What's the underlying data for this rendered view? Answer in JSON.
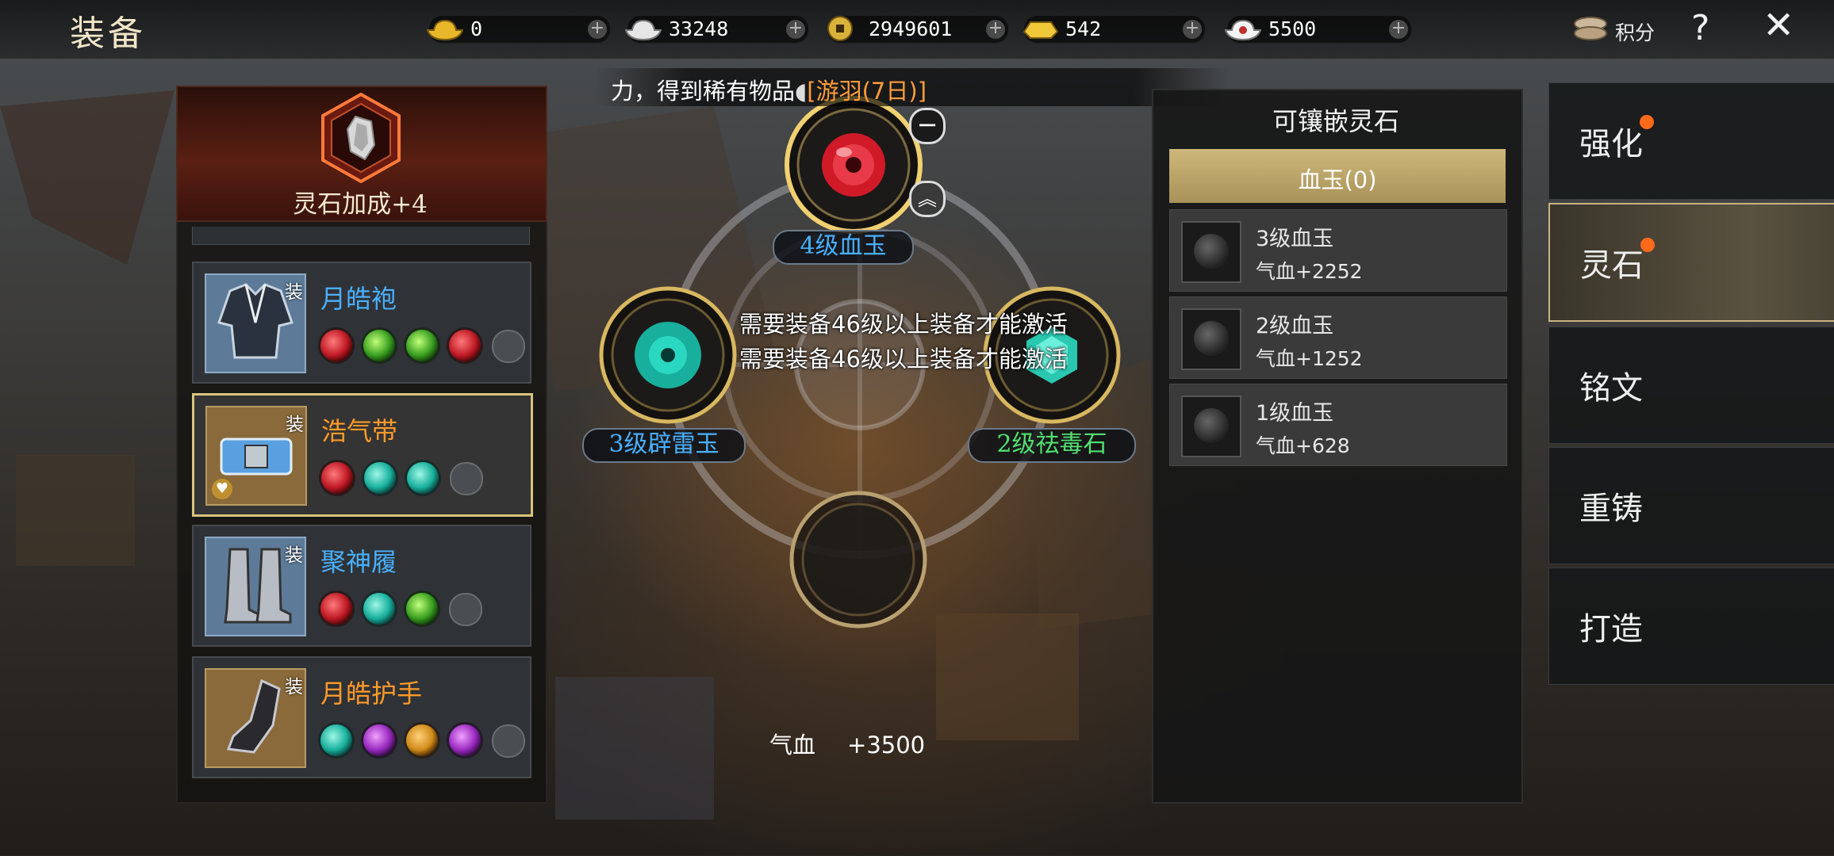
{
  "header": {
    "title": "装备",
    "currencies": [
      {
        "icon": "gold-ingot-icon",
        "value": "0"
      },
      {
        "icon": "silver-ingot-icon",
        "value": "33248"
      },
      {
        "icon": "copper-coin-icon",
        "value": "2949601"
      },
      {
        "icon": "gold-bar-icon",
        "value": "542"
      },
      {
        "icon": "silver-bar-icon",
        "value": "5500"
      }
    ],
    "plus_symbol": "+",
    "score_label": "积分",
    "help_symbol": "?",
    "close_symbol": "✕"
  },
  "notice": {
    "text": "力，得到稀有物品",
    "item": "[游羽(7日)]"
  },
  "left_panel": {
    "header_label": "灵石加成+4",
    "items": [
      {
        "name": "月皓袍",
        "tag": "装",
        "color": "blue",
        "gems": [
          "red",
          "green",
          "green",
          "red",
          "empty"
        ]
      },
      {
        "name": "浩气带",
        "tag": "装",
        "color": "orange",
        "selected": true,
        "gems": [
          "red",
          "teal",
          "teal",
          "empty"
        ]
      },
      {
        "name": "聚神履",
        "tag": "装",
        "color": "blue",
        "gems": [
          "red",
          "teal",
          "green",
          "empty"
        ]
      },
      {
        "name": "月皓护手",
        "tag": "装",
        "color": "orange",
        "gems": [
          "teal",
          "purple",
          "amber",
          "purple",
          "empty"
        ]
      }
    ]
  },
  "center": {
    "slot_top_label": "4级血玉",
    "slot_left_label": "3级辟雷玉",
    "slot_right_label": "2级祛毒石",
    "warning_1": "需要装备46级以上装备才能激活",
    "warning_2": "需要装备46级以上装备才能激活",
    "stat_label": "气血",
    "stat_value": "+3500"
  },
  "right_panel": {
    "title": "可镶嵌灵石",
    "filter_tab": "血玉(0)",
    "rows": [
      {
        "name": "3级血玉",
        "stat": "气血+2252"
      },
      {
        "name": "2级血玉",
        "stat": "气血+1252"
      },
      {
        "name": "1级血玉",
        "stat": "气血+628"
      }
    ]
  },
  "side_tabs": [
    {
      "label": "强化",
      "badge": true
    },
    {
      "label": "灵石",
      "badge": true,
      "active": true
    },
    {
      "label": "铭文",
      "badge": false
    },
    {
      "label": "重铸",
      "badge": false
    },
    {
      "label": "打造",
      "badge": false
    }
  ],
  "colors": {
    "accent_gold": "#d9c37c",
    "blue_text": "#49b0ff",
    "orange_text": "#ff9a2a",
    "green_text": "#50e070",
    "badge": "#ff6a1a"
  }
}
